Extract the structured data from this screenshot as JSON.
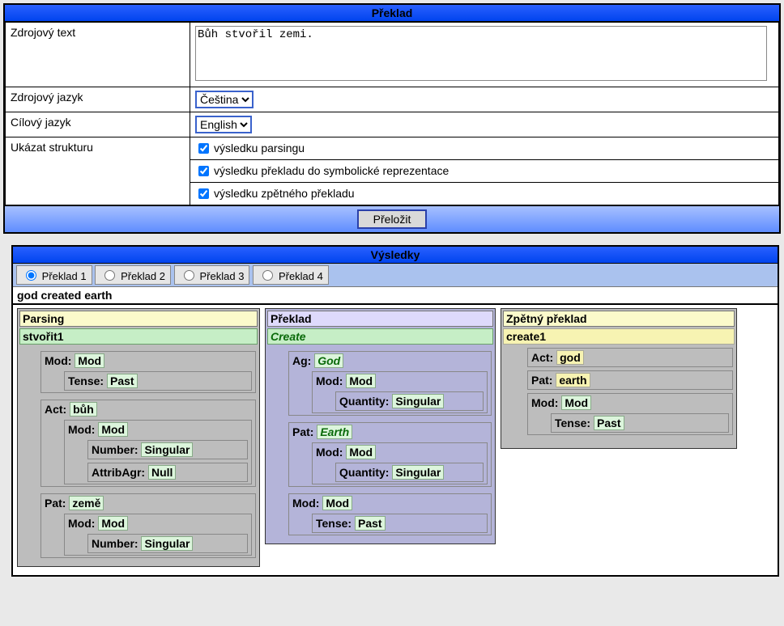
{
  "topPanel": {
    "title": "Překlad",
    "labels": {
      "source_text": "Zdrojový text",
      "source_lang": "Zdrojový jazyk",
      "target_lang": "Cílový jazyk",
      "show_struct": "Ukázat strukturu"
    },
    "source_text_value": "Bůh stvořil zemi.",
    "source_lang_value": "Čeština",
    "target_lang_value": "English",
    "checkboxes": {
      "parsing": "výsledku parsingu",
      "symbolic": "výsledku překladu do symbolické reprezentace",
      "back": "výsledku zpětného překladu"
    },
    "submit": "Přeložit"
  },
  "results": {
    "title": "Výsledky",
    "tabs": [
      "Překlad 1",
      "Překlad 2",
      "Překlad 3",
      "Překlad 4"
    ],
    "active_tab": 0,
    "sentence": "god created earth",
    "col1": {
      "title": "Parsing",
      "root": "stvořit1",
      "n_mod_label": "Mod:",
      "n_mod_value": "Mod",
      "n_mod_tense_label": "Tense:",
      "n_mod_tense_value": "Past",
      "n_act_label": "Act:",
      "n_act_value": "bůh",
      "n_act_mod_label": "Mod:",
      "n_act_mod_value": "Mod",
      "n_act_num_label": "Number:",
      "n_act_num_value": "Singular",
      "n_act_attr_label": "AttribAgr:",
      "n_act_attr_value": "Null",
      "n_pat_label": "Pat:",
      "n_pat_value": "země",
      "n_pat_mod_label": "Mod:",
      "n_pat_mod_value": "Mod",
      "n_pat_num_label": "Number:",
      "n_pat_num_value": "Singular"
    },
    "col2": {
      "title": "Překlad",
      "root": "Create",
      "ag_label": "Ag:",
      "ag_value": "God",
      "ag_mod_label": "Mod:",
      "ag_mod_value": "Mod",
      "ag_q_label": "Quantity:",
      "ag_q_value": "Singular",
      "pat_label": "Pat:",
      "pat_value": "Earth",
      "pat_mod_label": "Mod:",
      "pat_mod_value": "Mod",
      "pat_q_label": "Quantity:",
      "pat_q_value": "Singular",
      "mod_label": "Mod:",
      "mod_value": "Mod",
      "tense_label": "Tense:",
      "tense_value": "Past"
    },
    "col3": {
      "title": "Zpětný překlad",
      "root": "create1",
      "act_label": "Act:",
      "act_value": "god",
      "pat_label": "Pat:",
      "pat_value": "earth",
      "mod_label": "Mod:",
      "mod_value": "Mod",
      "tense_label": "Tense:",
      "tense_value": "Past"
    }
  }
}
